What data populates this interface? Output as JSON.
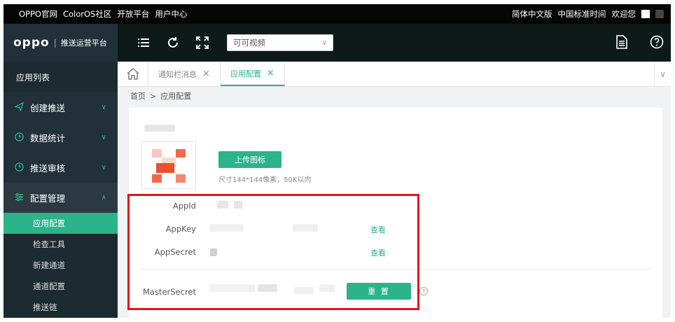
{
  "topbar": {
    "links": [
      "OPPO官网",
      "ColorOS社区",
      "开放平台",
      "用户中心"
    ],
    "language": "简体中文版",
    "timezone": "中国标准时间",
    "welcome": "欢迎您"
  },
  "brand": {
    "logo": "oppo",
    "separator": "|",
    "platform": "推送运营平台"
  },
  "header": {
    "app_select": {
      "value": "可可视频"
    },
    "icons": [
      "menu-icon",
      "refresh-icon",
      "fullscreen-icon",
      "document-icon",
      "help-icon"
    ]
  },
  "sidebar": {
    "title": "应用列表",
    "menus": [
      {
        "label": "创建推送",
        "icon": "send-icon"
      },
      {
        "label": "数据统计",
        "icon": "clock-icon"
      },
      {
        "label": "推送审核",
        "icon": "clock-icon"
      },
      {
        "label": "配置管理",
        "icon": "sliders-icon"
      }
    ],
    "submenu": [
      "应用配置",
      "检查工具",
      "新建通道",
      "通道配置",
      "推送链"
    ]
  },
  "tabs": [
    {
      "label": "通知栏消息",
      "active": false
    },
    {
      "label": "应用配置",
      "active": true
    }
  ],
  "breadcrumb": {
    "home": "首页",
    "sep": ">",
    "current": "应用配置"
  },
  "config": {
    "upload_label": "上传图标",
    "upload_hint": "尺寸144*144像素，50K以内",
    "fields": [
      {
        "label": "AppId",
        "action": ""
      },
      {
        "label": "AppKey",
        "action": "查看"
      },
      {
        "label": "AppSecret",
        "action": "查看"
      }
    ],
    "master_secret_label": "MasterSecret",
    "reset_label": "重 置"
  },
  "colors": {
    "accent": "#2bb38a",
    "highlight": "#e0141e",
    "dark": "#22303a"
  }
}
